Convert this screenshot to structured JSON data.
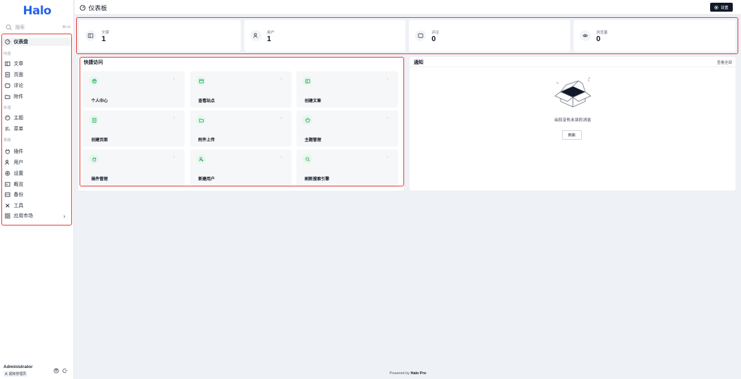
{
  "app": {
    "logo": "Halo",
    "page_title": "仪表板",
    "settings_label": "设置"
  },
  "search": {
    "placeholder": "搜索",
    "shortcut": "⌘+K"
  },
  "sidebar": {
    "dashboard": "仪表盘",
    "groups": {
      "content": "内容",
      "appearance": "外观",
      "system": "系统"
    },
    "content_items": [
      "文章",
      "页面",
      "评论",
      "附件"
    ],
    "appearance_items": [
      "主题",
      "菜单"
    ],
    "system_items": [
      "插件",
      "用户",
      "设置",
      "概览",
      "备份",
      "工具",
      "应用市场"
    ],
    "market_chevron": "›"
  },
  "user": {
    "name": "Administrator",
    "role": "超级管理员"
  },
  "stats": [
    {
      "label": "文章",
      "value": "1",
      "icon": "post-icon"
    },
    {
      "label": "用户",
      "value": "1",
      "icon": "user-icon"
    },
    {
      "label": "评论",
      "value": "0",
      "icon": "comment-icon"
    },
    {
      "label": "浏览量",
      "value": "0",
      "icon": "eye-icon"
    }
  ],
  "quick_access": {
    "title": "快捷访问",
    "arrow": "›",
    "items": [
      "个人中心",
      "查看站点",
      "创建文章",
      "创建页面",
      "附件上传",
      "主题管理",
      "插件管理",
      "新建用户",
      "刷新搜索引擎"
    ]
  },
  "notifications": {
    "title": "通知",
    "view_all": "查看全部",
    "empty_text": "当前没有未读的消息",
    "refresh": "刷新"
  },
  "footer": {
    "prefix": "Powered by",
    "brand": "Halo Pro"
  },
  "colors": {
    "accent_blue": "#2563eb",
    "highlight_red": "#e53935",
    "icon_green": "#16a34a",
    "dark_button": "#111827"
  }
}
